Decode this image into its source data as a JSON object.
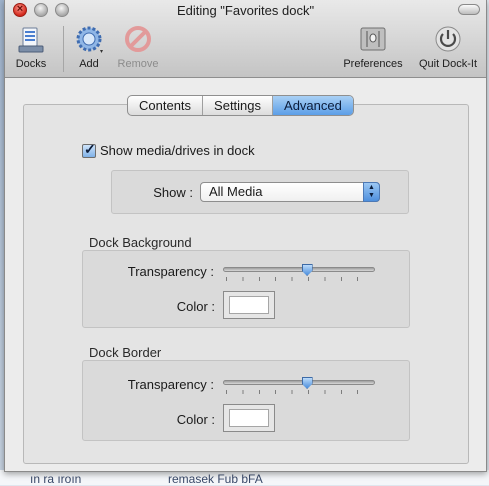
{
  "window": {
    "title": "Editing \"Favorites dock\""
  },
  "toolbar": {
    "docks_label": "Docks",
    "add_label": "Add",
    "remove_label": "Remove",
    "preferences_label": "Preferences",
    "quit_label": "Quit Dock-It"
  },
  "tabs": [
    {
      "label": "Contents",
      "active": false
    },
    {
      "label": "Settings",
      "active": false
    },
    {
      "label": "Advanced",
      "active": true
    }
  ],
  "show_media": {
    "label": "Show media/drives in dock",
    "checked": true
  },
  "show": {
    "label": "Show :",
    "value": "All Media"
  },
  "dock_background": {
    "title": "Dock Background",
    "transparency_label": "Transparency :",
    "transparency_value": 0.55,
    "color_label": "Color :",
    "color": "#ffffff"
  },
  "dock_border": {
    "title": "Dock Border",
    "transparency_label": "Transparency :",
    "transparency_value": 0.55,
    "color_label": "Color :",
    "color": "#ffffff"
  },
  "background_app": {
    "text_a": "ın ra ıroın",
    "text_b": "remasek Fub bFA"
  },
  "colors": {
    "accent": "#5c9ee7",
    "close": "#d2281c"
  }
}
